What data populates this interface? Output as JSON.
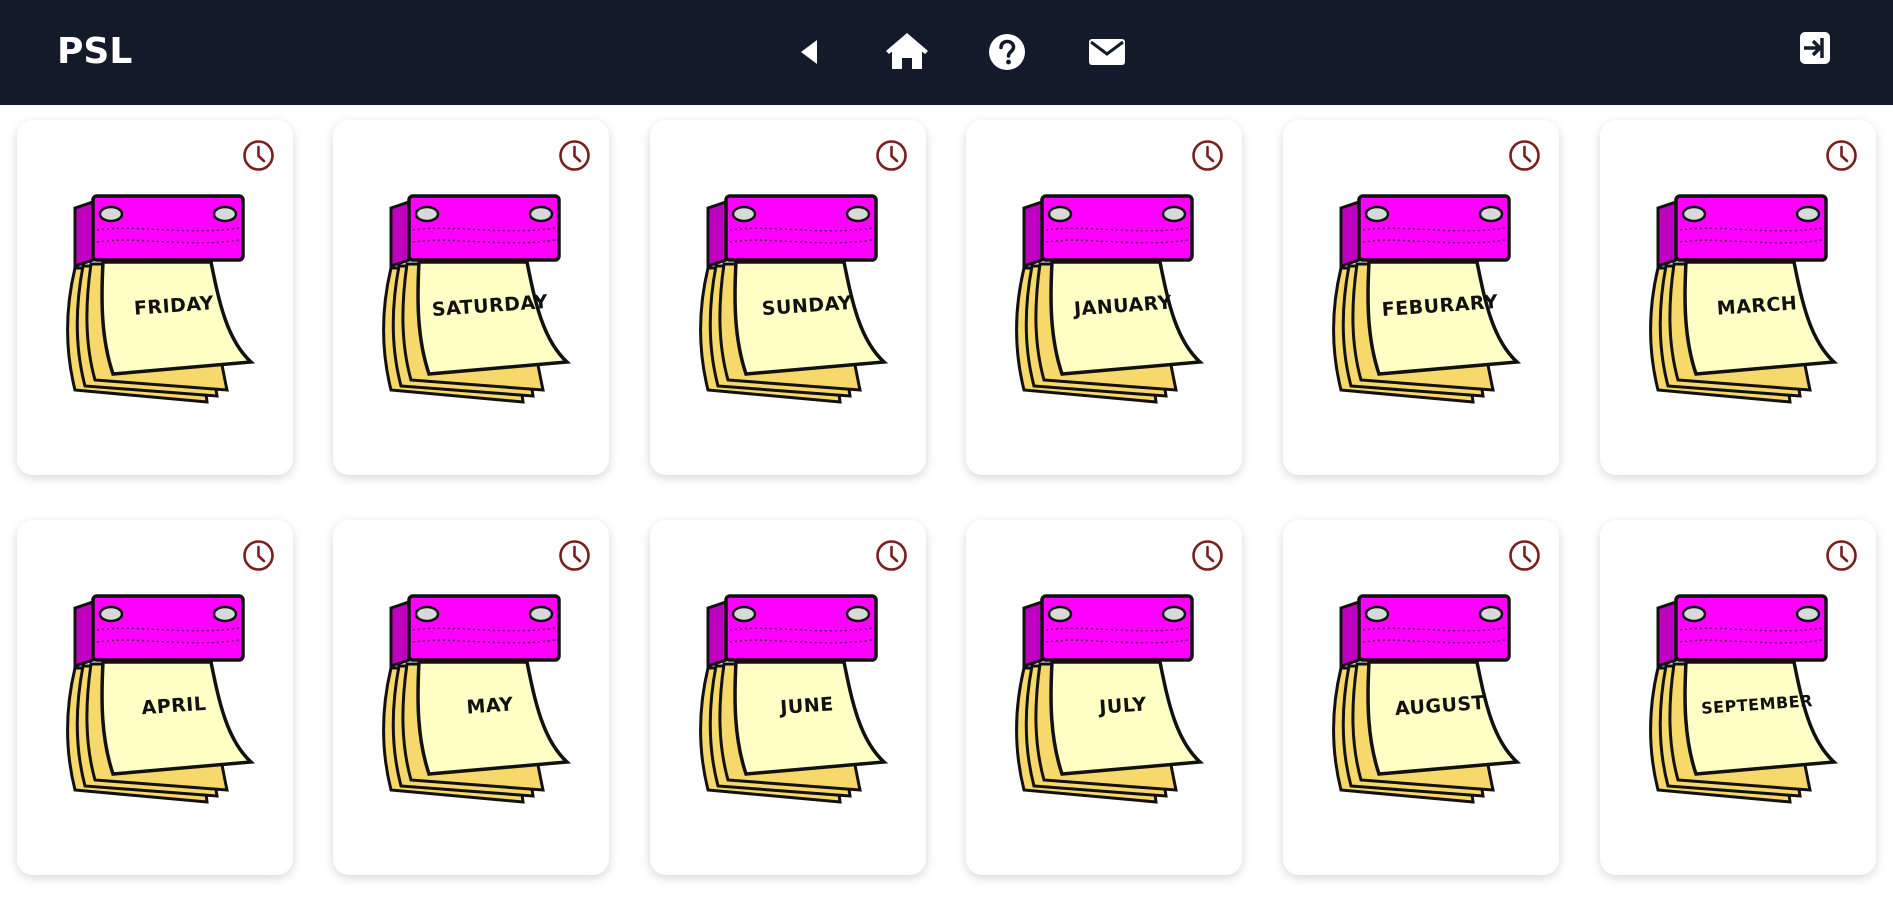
{
  "app": {
    "brand": "PSL"
  },
  "navbar": {
    "icons": [
      "back-icon",
      "home-icon",
      "help-icon",
      "mail-icon",
      "logout-icon"
    ]
  },
  "colors": {
    "navbar": "#131a2a",
    "binder": "#ff00ff",
    "page": "#ffffc6",
    "page_stack": "#f7d86a",
    "clock": "#7a1f1f"
  },
  "cards": [
    {
      "label": "FRIDAY"
    },
    {
      "label": "SATURDAY"
    },
    {
      "label": "SUNDAY"
    },
    {
      "label": "JANUARY"
    },
    {
      "label": "FEBURARY"
    },
    {
      "label": "MARCH"
    },
    {
      "label": "APRIL"
    },
    {
      "label": "MAY"
    },
    {
      "label": "JUNE"
    },
    {
      "label": "JULY"
    },
    {
      "label": "AUGUST"
    },
    {
      "label": "SEPTEMBER"
    }
  ]
}
